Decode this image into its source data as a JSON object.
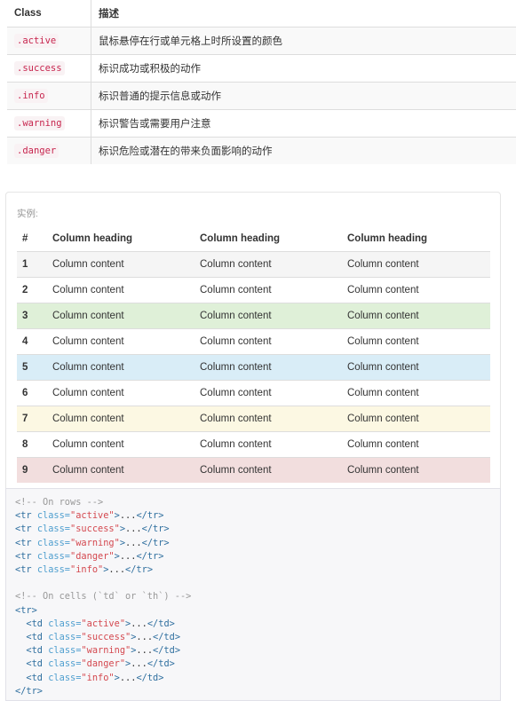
{
  "reference": {
    "headers": [
      "Class",
      "描述"
    ],
    "rows": [
      {
        "cls": ".active",
        "desc": "鼠标悬停在行或单元格上时所设置的颜色"
      },
      {
        "cls": ".success",
        "desc": "标识成功或积极的动作"
      },
      {
        "cls": ".info",
        "desc": "标识普通的提示信息或动作"
      },
      {
        "cls": ".warning",
        "desc": "标识警告或需要用户注意"
      },
      {
        "cls": ".danger",
        "desc": "标识危险或潜在的带来负面影响的动作"
      }
    ]
  },
  "example": {
    "label": "实例:",
    "headers": [
      "#",
      "Column heading",
      "Column heading",
      "Column heading"
    ],
    "rows": [
      {
        "n": "1",
        "c": [
          "Column content",
          "Column content",
          "Column content"
        ],
        "bg": "#f5f5f5"
      },
      {
        "n": "2",
        "c": [
          "Column content",
          "Column content",
          "Column content"
        ],
        "bg": "#ffffff"
      },
      {
        "n": "3",
        "c": [
          "Column content",
          "Column content",
          "Column content"
        ],
        "bg": "#dff0d8"
      },
      {
        "n": "4",
        "c": [
          "Column content",
          "Column content",
          "Column content"
        ],
        "bg": "#ffffff"
      },
      {
        "n": "5",
        "c": [
          "Column content",
          "Column content",
          "Column content"
        ],
        "bg": "#d9edf7"
      },
      {
        "n": "6",
        "c": [
          "Column content",
          "Column content",
          "Column content"
        ],
        "bg": "#ffffff"
      },
      {
        "n": "7",
        "c": [
          "Column content",
          "Column content",
          "Column content"
        ],
        "bg": "#fcf8e3"
      },
      {
        "n": "8",
        "c": [
          "Column content",
          "Column content",
          "Column content"
        ],
        "bg": "#ffffff"
      },
      {
        "n": "9",
        "c": [
          "Column content",
          "Column content",
          "Column content"
        ],
        "bg": "#f2dede"
      }
    ]
  },
  "code_lines": [
    [
      [
        "c",
        "<!-- On rows -->"
      ]
    ],
    [
      [
        "t",
        "<tr "
      ],
      [
        "a",
        "class="
      ],
      [
        "s",
        "\"active\""
      ],
      [
        "t",
        ">"
      ],
      [
        "p",
        "..."
      ],
      [
        "t",
        "</tr>"
      ]
    ],
    [
      [
        "t",
        "<tr "
      ],
      [
        "a",
        "class="
      ],
      [
        "s",
        "\"success\""
      ],
      [
        "t",
        ">"
      ],
      [
        "p",
        "..."
      ],
      [
        "t",
        "</tr>"
      ]
    ],
    [
      [
        "t",
        "<tr "
      ],
      [
        "a",
        "class="
      ],
      [
        "s",
        "\"warning\""
      ],
      [
        "t",
        ">"
      ],
      [
        "p",
        "..."
      ],
      [
        "t",
        "</tr>"
      ]
    ],
    [
      [
        "t",
        "<tr "
      ],
      [
        "a",
        "class="
      ],
      [
        "s",
        "\"danger\""
      ],
      [
        "t",
        ">"
      ],
      [
        "p",
        "..."
      ],
      [
        "t",
        "</tr>"
      ]
    ],
    [
      [
        "t",
        "<tr "
      ],
      [
        "a",
        "class="
      ],
      [
        "s",
        "\"info\""
      ],
      [
        "t",
        ">"
      ],
      [
        "p",
        "..."
      ],
      [
        "t",
        "</tr>"
      ]
    ],
    [],
    [
      [
        "c",
        "<!-- On cells (`td` or `th`) -->"
      ]
    ],
    [
      [
        "t",
        "<tr>"
      ]
    ],
    [
      [
        "p",
        "  "
      ],
      [
        "t",
        "<td "
      ],
      [
        "a",
        "class="
      ],
      [
        "s",
        "\"active\""
      ],
      [
        "t",
        ">"
      ],
      [
        "p",
        "..."
      ],
      [
        "t",
        "</td>"
      ]
    ],
    [
      [
        "p",
        "  "
      ],
      [
        "t",
        "<td "
      ],
      [
        "a",
        "class="
      ],
      [
        "s",
        "\"success\""
      ],
      [
        "t",
        ">"
      ],
      [
        "p",
        "..."
      ],
      [
        "t",
        "</td>"
      ]
    ],
    [
      [
        "p",
        "  "
      ],
      [
        "t",
        "<td "
      ],
      [
        "a",
        "class="
      ],
      [
        "s",
        "\"warning\""
      ],
      [
        "t",
        ">"
      ],
      [
        "p",
        "..."
      ],
      [
        "t",
        "</td>"
      ]
    ],
    [
      [
        "p",
        "  "
      ],
      [
        "t",
        "<td "
      ],
      [
        "a",
        "class="
      ],
      [
        "s",
        "\"danger\""
      ],
      [
        "t",
        ">"
      ],
      [
        "p",
        "..."
      ],
      [
        "t",
        "</td>"
      ]
    ],
    [
      [
        "p",
        "  "
      ],
      [
        "t",
        "<td "
      ],
      [
        "a",
        "class="
      ],
      [
        "s",
        "\"info\""
      ],
      [
        "t",
        ">"
      ],
      [
        "p",
        "..."
      ],
      [
        "t",
        "</td>"
      ]
    ],
    [
      [
        "t",
        "</tr>"
      ]
    ]
  ]
}
